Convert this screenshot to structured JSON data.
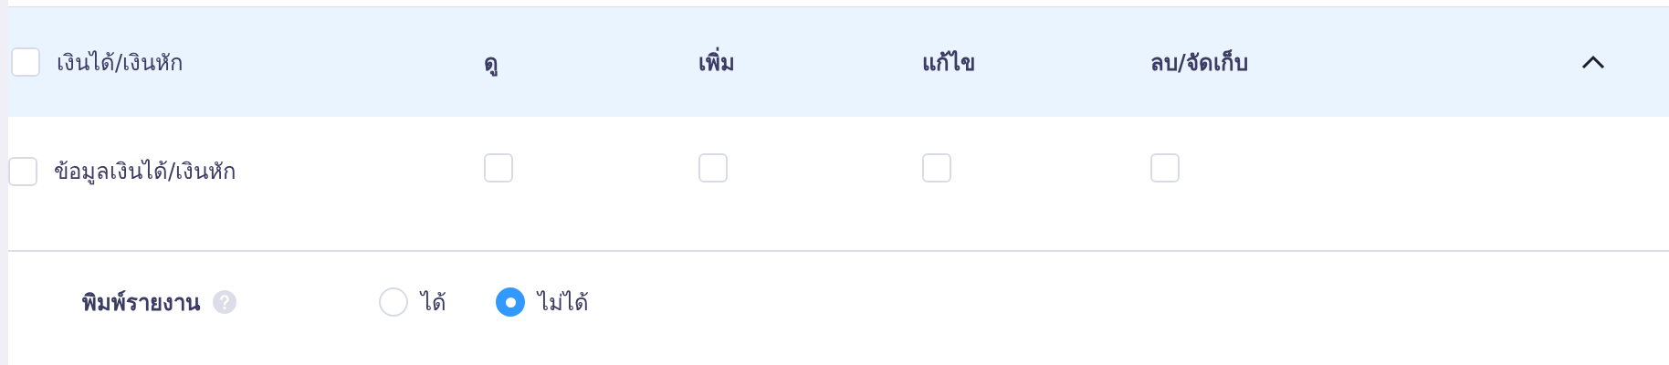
{
  "header": {
    "checked": false,
    "label": "เงินได้/เงินหัก",
    "columns": [
      "ดู",
      "เพิ่ม",
      "แก้ไข",
      "ลบ/จัดเก็บ"
    ],
    "expanded": true
  },
  "rows": [
    {
      "label": "ข้อมูลเงินได้/เงินหัก",
      "checked": false,
      "permissions": [
        {
          "checked": false
        },
        {
          "checked": false
        },
        {
          "checked": false
        },
        {
          "checked": false
        }
      ]
    }
  ],
  "print": {
    "label": "พิมพ์รายงาน",
    "options": [
      {
        "label": "ได้",
        "selected": false
      },
      {
        "label": "ไม่ได้",
        "selected": true
      }
    ]
  }
}
